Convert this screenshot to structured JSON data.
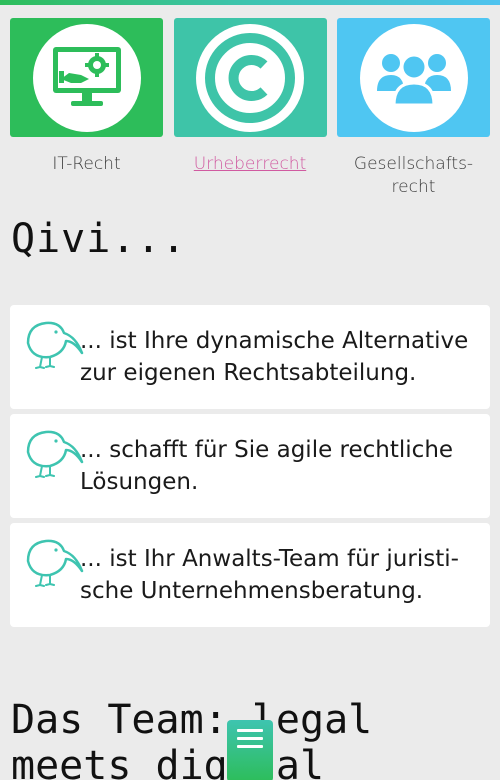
{
  "colors": {
    "tile_it": "#2dbd5a",
    "tile_copyright": "#3ec4a8",
    "tile_company": "#4fc6f2",
    "kiwi_outline": "#3ec4b0",
    "link": "#d05aa0"
  },
  "tiles": [
    {
      "label": "IT-Recht",
      "icon": "computer-gear-icon",
      "active": false
    },
    {
      "label": "Urheberrecht",
      "icon": "copyright-icon",
      "active": true
    },
    {
      "label_line1": "Gesellschafts-",
      "label_line2": "recht",
      "icon": "people-group-icon",
      "active": false
    }
  ],
  "qivi": {
    "heading": "Qivi...",
    "items": [
      {
        "text": "... ist Ihre dynamische Alternative zur eigenen Rechtsabteilung.",
        "icon": "kiwi-bird-icon"
      },
      {
        "text": "... schafft für Sie agile rechtliche Lösungen.",
        "icon": "kiwi-bird-icon"
      },
      {
        "text": "... ist Ihr Anwalts-Team für juristi-sche Unternehmensberatung.",
        "icon": "kiwi-bird-icon"
      }
    ]
  },
  "team": {
    "heading": "Das Team: legal meets digital"
  },
  "menu_button": {
    "icon": "hamburger-menu-icon"
  }
}
